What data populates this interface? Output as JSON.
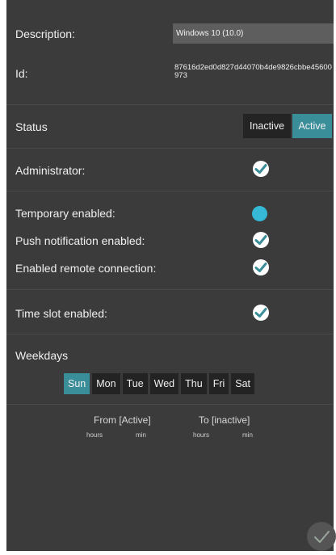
{
  "fields": {
    "description_label": "Description:",
    "description_value": "Windows 10 (10.0)",
    "id_label": "Id:",
    "id_value": "87616d2ed0d827d44070b4de9826cbbe45600973"
  },
  "status": {
    "label": "Status",
    "options": [
      "Inactive",
      "Active"
    ],
    "selected": "Active"
  },
  "toggles": {
    "administrator": {
      "label": "Administrator:",
      "checked": true
    },
    "temporary": {
      "label": "Temporary enabled:",
      "checked": false
    },
    "push": {
      "label": "Push notification enabled:",
      "checked": true
    },
    "remote": {
      "label": "Enabled remote connection:",
      "checked": true
    },
    "time_slot": {
      "label": "Time slot enabled:",
      "checked": true
    }
  },
  "weekdays": {
    "label": "Weekdays",
    "days": [
      "Sun",
      "Mon",
      "Tue",
      "Wed",
      "Thu",
      "Fri",
      "Sat"
    ],
    "selected": "Sun"
  },
  "time_range": {
    "from_label": "From [Active]",
    "to_label": "To [inactive]",
    "hours_label": "hours",
    "min_label": "min"
  },
  "colors": {
    "accent": "#3a8e99",
    "background": "#3b3b3b",
    "dot": "#35b9d6"
  },
  "icons": {
    "check": "check-icon",
    "save": "save-check-icon"
  }
}
